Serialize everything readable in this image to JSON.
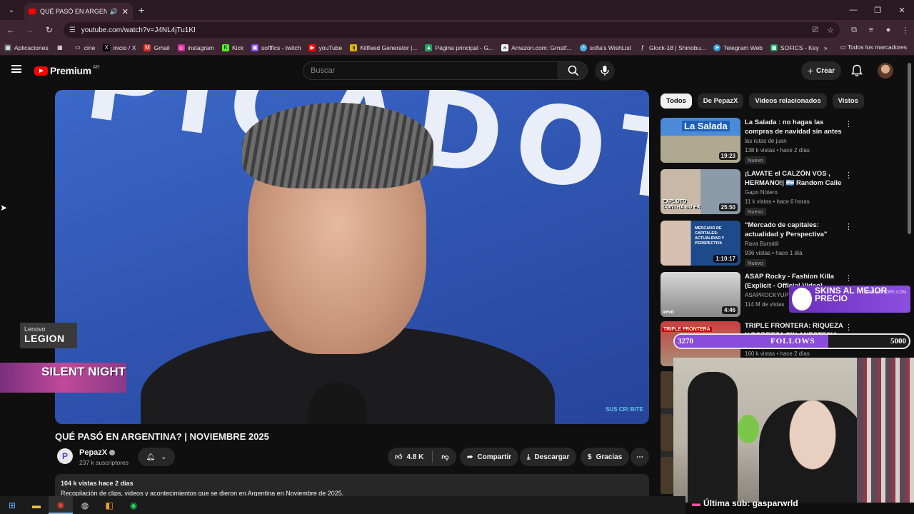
{
  "browser": {
    "tab_title": "QUÉ PASÓ EN ARGENTINA",
    "url": "youtube.com/watch?v=J4NL4jTu1KI",
    "bookmarks": [
      "Aplicaciones",
      "cine",
      "inicio / X",
      "Gmail",
      "instagram",
      "Kick",
      "sofffics - twitch",
      "youTube",
      "Killfeed Generator |...",
      "Página principal - G...",
      "Amazon.com: Grnstf...",
      "sofia's WishList",
      "Glock-18 | Shinobu...",
      "Telegram Web",
      "SOFICS - Key"
    ],
    "bookmarks_all": "Todos los marcadores"
  },
  "masthead": {
    "brand": "Premium",
    "country": "AR",
    "search_placeholder": "Buscar",
    "create_label": "Crear"
  },
  "video": {
    "title": "QUÉ PASÓ EN ARGENTINA? | NOVIEMBRE 2025",
    "channel": "PepazX",
    "channel_initial": "P",
    "subscribers": "237 k suscriptores",
    "likes": "4.8 K",
    "share_label": "Compartir",
    "download_label": "Descargar",
    "thanks_label": "Gracias",
    "views_date": "104 k vistas  hace 2 días",
    "description": "Recopilación de clips, videos y acontecimientos que se dieron en Argentina en Noviembre de 2025.",
    "watermark": "SUS CRI BITE",
    "bg_letters": "PICADOT"
  },
  "chips": [
    "Todos",
    "De PepazX",
    "Videos relacionados",
    "Vistos"
  ],
  "recommendations": [
    {
      "title": "La Salada : no hagas las compras de navidad sin antes ...",
      "channel": "las rutas de juan",
      "meta": "138 k vistas • hace 2 días",
      "badge": "Nuevo",
      "duration": "19:23",
      "thumb_label": "La Salada"
    },
    {
      "title": "¡LAVATE el CALZÓN VOS , HERMANO!| 🇦🇷 Random Calle ...",
      "channel": "Gapo Notero",
      "meta": "11 k vistas • hace 6 horas",
      "badge": "Nuevo",
      "duration": "25:50",
      "thumb_label": "EXPLOTÓ CONTRA SU EX"
    },
    {
      "title": "\"Mercado de capitales: actualidad y Perspectiva\"",
      "channel": "Rava Bursátil",
      "meta": "936 vistas • hace 1 día",
      "badge": "Nuevo",
      "duration": "1:10:17",
      "thumb_label": "MERCADO DE CAPITALES: ACTUALIDAD Y PERSPECTIVA"
    },
    {
      "title": "ASAP Rocky - Fashion Killa (Explicit - Official Video)",
      "channel": "ASAPROCKYUPTOWN",
      "meta": "114 M de vistas",
      "badge": "",
      "duration": "4:46",
      "thumb_label": "vevo"
    },
    {
      "title": "TRIPLE FRONTERA: RIQUEZA Y POBREZA SIN ANESTESIA ...",
      "channel": "",
      "meta": "160 k vistas • hace 2 días",
      "badge": "",
      "duration": "",
      "thumb_label": "TRIPLE FRONTERA"
    }
  ],
  "overlays": {
    "legion_l1": "Lenovo",
    "legion_l2": "LEGION",
    "silent_night": "SILENT NIGHT",
    "skins_text": "SKINS AL MEJOR PRECIO",
    "skins_domain": "PANDASTORE.COM",
    "follows_current": "3270",
    "follows_label": "FOLLOWS",
    "follows_goal": "5000",
    "follows_fraction": 0.654,
    "last_sub": "Última sub: gasparwrld"
  }
}
